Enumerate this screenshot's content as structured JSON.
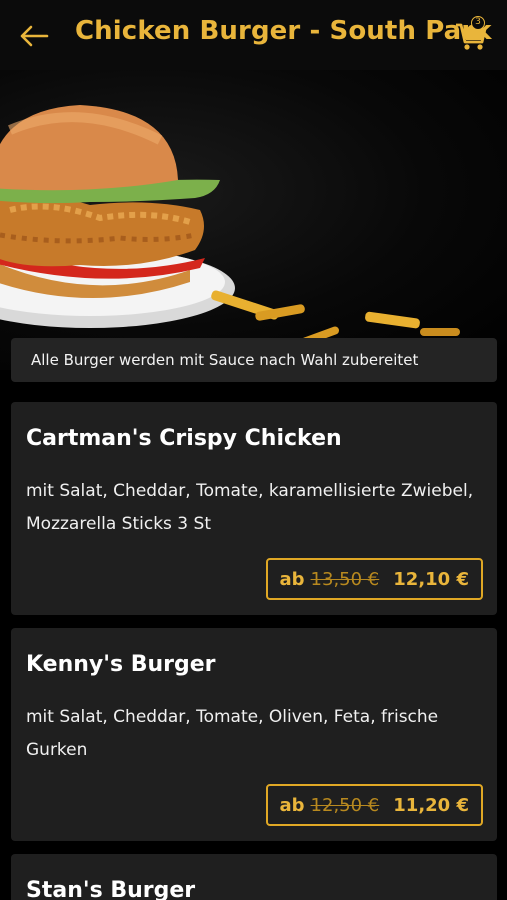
{
  "header": {
    "title": "Chicken Burger - South Park",
    "cart_count": "3",
    "accent": "#e9b53b"
  },
  "hero": {
    "image": "chicken-burger-photo"
  },
  "notice": "Alle Burger werden mit Sauce nach Wahl zubereitet",
  "items": [
    {
      "name": "Cartman's Crispy Chicken",
      "description": "mit Salat, Cheddar, Tomate, karamellisierte Zwiebel, Mozzarella Sticks 3 St",
      "price_prefix": "ab",
      "old_price": "13,50 €",
      "new_price": "12,10 €"
    },
    {
      "name": "Kenny's Burger",
      "description": "mit Salat, Cheddar, Tomate, Oliven, Feta, frische Gurken",
      "price_prefix": "ab",
      "old_price": "12,50 €",
      "new_price": "11,20 €"
    },
    {
      "name": "Stan's Burger"
    }
  ]
}
